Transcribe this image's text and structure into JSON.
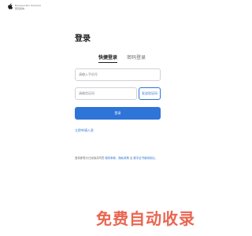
{
  "brand": {
    "line1": "Bureaucratic Practical",
    "line2": "研究机构"
  },
  "page_title": "登录",
  "tabs": [
    {
      "label": "快捷登录",
      "active": true
    },
    {
      "label": "密码登录",
      "active": false
    }
  ],
  "phone_input": {
    "placeholder": "请输入手机号"
  },
  "code_input": {
    "placeholder": "请输验证码"
  },
  "code_button_label": "发送验证码",
  "login_button_label": "登录",
  "register_link": "立即申请入驻",
  "agreement": {
    "prefix": "登录即表示已阅读并同意",
    "link1": "服务条款",
    "sep": "、",
    "link2": "隐私政策",
    "and": "及",
    "link3": "数字证书使用协议",
    "suffix": "。"
  },
  "watermark": "免费自动收录",
  "colors": {
    "accent": "#2f74d8",
    "watermark": "#e8553e"
  }
}
